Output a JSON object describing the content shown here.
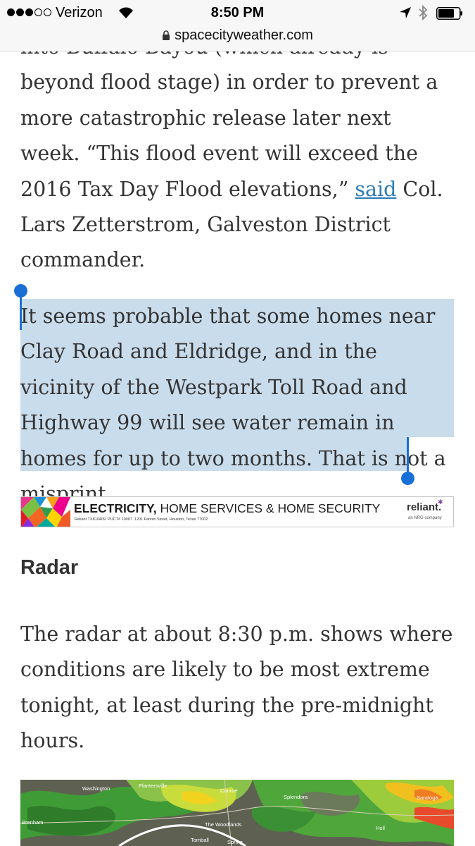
{
  "status_bar": {
    "carrier": "Verizon",
    "time": "8:50 PM",
    "signal_bars_filled": 3,
    "signal_bars_total": 5
  },
  "browser": {
    "url": "spacecityweather.com"
  },
  "article": {
    "para1": {
      "clipped_line": "into Buffalo Bayou (which already is",
      "text_before_link": "beyond flood stage) in order to prevent a more catastrophic release later next week. “This flood event will exceed the 2016 Tax Day Flood elevations,” ",
      "link_text": "said",
      "text_after_link": " Col. Lars Zetterstrom, Galveston District commander."
    },
    "para2_selected": "It seems probable that some homes near Clay Road and Eldridge, and in the vicinity of the Westpark Toll Road and Highway 99 will see water remain in homes for up to two months. That is not a misprint.",
    "ad": {
      "headline_bold": "ELECTRICITY,",
      "headline_rest": " HOME SERVICES & HOME SECURITY",
      "fine_print": "Reliant TX810409. PUCT# 10007. 1201 Fannin Street, Houston, Texas 77002",
      "brand": "reliant.",
      "brand_sub": "an NRG company"
    },
    "radar_heading": "Radar",
    "para3": "The radar at about 8:30 p.m. shows where conditions are likely to be most extreme tonight, at least during the pre-midnight hours.",
    "map_labels": {
      "washington": "Washington",
      "plantersville": "Plantersville",
      "conroe": "Conroe",
      "splendora": "Splendora",
      "saratoga": "Saratoga",
      "brenham": "Brenham",
      "the_woodlands": "The Woodlands",
      "tomball": "Tomball",
      "spring": "Spring",
      "hull": "Hull"
    }
  },
  "colors": {
    "link": "#2b7bb9",
    "selection": "#c9dcec",
    "selection_handle": "#1a6fd6",
    "body_text": "#333333"
  }
}
